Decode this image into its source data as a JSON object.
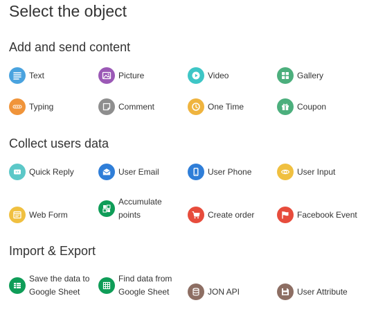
{
  "title": "Select the object",
  "sections": {
    "add": "Add and send content",
    "collect": "Collect users data",
    "import": "Import & Export"
  },
  "items": {
    "text": "Text",
    "picture": "Picture",
    "video": "Video",
    "gallery": "Gallery",
    "typing": "Typing",
    "comment": "Comment",
    "one_time": "One Time",
    "coupon": "Coupon",
    "quick_reply": "Quick Reply",
    "user_email": "User Email",
    "user_phone": "User Phone",
    "user_input": "User Input",
    "web_form": "Web Form",
    "accumulate_points": "Accumulate points",
    "create_order": "Create order",
    "facebook_event": "Facebook Event",
    "save_to_sheet": "Save the data to Google Sheet",
    "find_in_sheet": "Find data from Google Sheet",
    "jon_api": "JON API",
    "user_attribute": "User Attribute"
  },
  "icons": {
    "text": "text-lines-icon",
    "picture": "picture-icon",
    "video": "play-icon",
    "gallery": "gallery-grid-icon",
    "typing": "typing-dots-icon",
    "comment": "comment-icon",
    "one_time": "clock-icon",
    "coupon": "gift-icon",
    "quick_reply": "quick-reply-icon",
    "user_email": "envelope-icon",
    "user_phone": "phone-icon",
    "user_input": "eye-icon",
    "web_form": "form-icon",
    "accumulate_points": "points-icon",
    "create_order": "cart-icon",
    "facebook_event": "flag-icon",
    "save_to_sheet": "sheet-icon",
    "find_in_sheet": "sheet-grid-icon",
    "jon_api": "database-icon",
    "user_attribute": "save-icon"
  },
  "colors": {
    "text": "#4aa3df",
    "picture": "#9b59b6",
    "video": "#3ec6c6",
    "gallery": "#4caf7d",
    "typing": "#f0943a",
    "comment": "#8e8e8e",
    "one_time": "#efb43f",
    "coupon": "#4caf7d",
    "quick_reply": "#5cc8c8",
    "user_email": "#2f7ed8",
    "user_phone": "#2f7ed8",
    "user_input": "#f0c040",
    "web_form": "#f0c040",
    "accumulate_points": "#0f9d58",
    "create_order": "#e74c3c",
    "facebook_event": "#e74c3c",
    "save_to_sheet": "#0f9d58",
    "find_in_sheet": "#0f9d58",
    "jon_api": "#8d6e63",
    "user_attribute": "#8d6e63"
  }
}
